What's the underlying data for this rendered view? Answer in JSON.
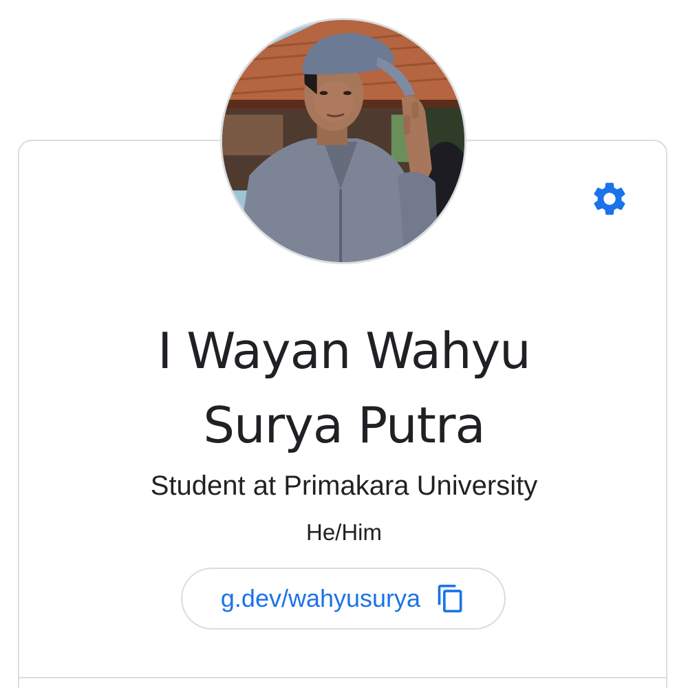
{
  "profile": {
    "name_line1": "I Wayan Wahyu",
    "name_line2": "Surya Putra",
    "title": "Student at Primakara University",
    "pronouns": "He/Him",
    "profile_link": "g.dev/wahyusurya"
  },
  "icons": {
    "settings": "gear-icon",
    "copy": "copy-icon",
    "avatar": "profile-photo"
  },
  "colors": {
    "accent": "#1a73e8",
    "text": "#202124",
    "border": "#dadce0"
  }
}
